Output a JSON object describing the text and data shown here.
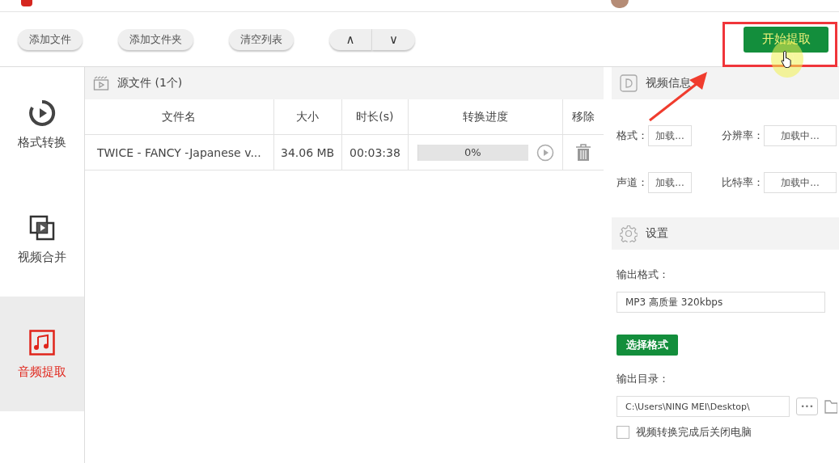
{
  "toolbar": {
    "buttons": [
      "添加文件",
      "添加文件夹",
      "清空列表"
    ],
    "move_up": "∧",
    "move_down": "∨",
    "start_button": "开始提取"
  },
  "sidebar": {
    "items": [
      {
        "label": "格式转换",
        "kind": "convert",
        "selected": false
      },
      {
        "label": "视频合并",
        "kind": "merge",
        "selected": false
      },
      {
        "label": "音频提取",
        "kind": "audio",
        "selected": true
      }
    ]
  },
  "file_list": {
    "title": "源文件 (1个)",
    "columns": [
      "文件名",
      "大小",
      "时长(s)",
      "转换进度",
      "移除"
    ],
    "rows": [
      {
        "name": "TWICE - FANCY -Japanese v...",
        "size": "34.06 MB",
        "duration": "00:03:38",
        "progress_text": "0%",
        "level": 0
      }
    ]
  },
  "video_info": {
    "title": "视频信息",
    "fields": [
      {
        "label": "格式：",
        "value": "加载...",
        "kind": "short"
      },
      {
        "label": "分辨率：",
        "value": "加载中...",
        "kind": "long"
      },
      {
        "label": "声道：",
        "value": "加载...",
        "kind": "short"
      },
      {
        "label": "比特率：",
        "value": "加载中...",
        "kind": "long"
      }
    ]
  },
  "settings": {
    "title": "设置",
    "output_format_label": "输出格式：",
    "output_format": "MP3 高质量 320kbps",
    "choose_format_button": "选择格式",
    "output_dir_label": "输出目录：",
    "output_dir": "C:\\Users\\NING MEI\\Desktop\\",
    "browse_button": "•••",
    "shutdown_checkbox": {
      "label": "视频转换完成后关闭电脑",
      "checked": false
    }
  }
}
